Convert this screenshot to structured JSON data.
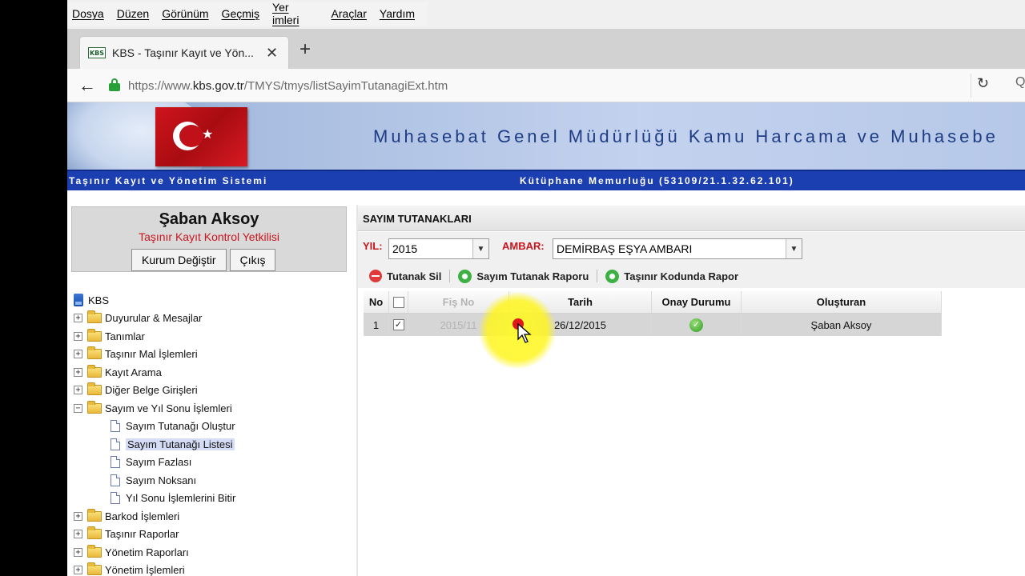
{
  "menu": [
    "Dosya",
    "Düzen",
    "Görünüm",
    "Geçmiş",
    "Yer imleri",
    "Araçlar",
    "Yardım"
  ],
  "tab": {
    "favicon": "KBS",
    "title": "KBS - Taşınır Kayıt ve Yön...",
    "close": "✕",
    "new_tab": "+"
  },
  "nav": {
    "back": "←",
    "url_scheme": "https://www.",
    "url_host": "kbs.gov.tr",
    "url_path": "/TMYS/tmys/listSayimTutanagiExt.htm",
    "reload": "↻",
    "search_peek": "Q"
  },
  "header": {
    "banner_title": "Muhasebat Genel Müdürlüğü Kamu Harcama ve Muhasebe",
    "system_name": "Taşınır Kayıt ve Yönetim Sistemi",
    "unit_info": "Kütüphane Memurluğu (53109/21.1.32.62.101)"
  },
  "user": {
    "name": "Şaban Aksoy",
    "role": "Taşınır Kayıt Kontrol Yetkilisi",
    "change_unit": "Kurum Değiştir",
    "logout": "Çıkış"
  },
  "tree": {
    "root": "KBS",
    "items": [
      "Duyurular & Mesajlar",
      "Tanımlar",
      "Taşınır Mal İşlemleri",
      "Kayıt Arama",
      "Diğer Belge Girişleri",
      "Sayım ve Yıl Sonu İşlemleri"
    ],
    "children": [
      "Sayım Tutanağı Oluştur",
      "Sayım Tutanağı Listesi",
      "Sayım Fazlası",
      "Sayım Noksanı",
      "Yıl Sonu İşlemlerini Bitir"
    ],
    "after": [
      "Barkod İşlemleri",
      "Taşınır Raporlar",
      "Yönetim Raporları",
      "Yönetim İşlemleri"
    ]
  },
  "main": {
    "title": "SAYIM TUTANAKLARI",
    "year_label": "YIL:",
    "year_value": "2015",
    "store_label": "AMBAR:",
    "store_value": "DEMİRBAŞ EŞYA AMBARI",
    "toolbar": {
      "delete": "Tutanak Sil",
      "count_report": "Sayım Tutanak Raporu",
      "code_report": "Taşınır Kodunda Rapor"
    },
    "columns": {
      "no": "No",
      "fis": "Fiş No",
      "tarih": "Tarih",
      "onay": "Onay Durumu",
      "olusturan": "Oluşturan"
    },
    "rows": [
      {
        "no": "1",
        "fis": "2015/11",
        "tarih": "26/12/2015",
        "olusturan": "Şaban Aksoy"
      }
    ]
  },
  "colors": {
    "brand_blue": "#1b3fb0",
    "accent_red": "#c8161e",
    "banner_text": "#1e3c84"
  }
}
